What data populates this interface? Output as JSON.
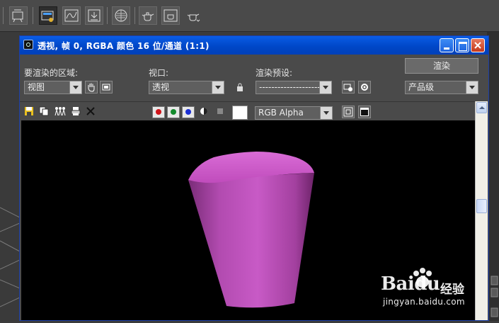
{
  "window": {
    "title": "透视, 帧 0, RGBA 颜色 16 位/通道 (1:1)"
  },
  "controls": {
    "area_label": "要渲染的区域:",
    "area_value": "视图",
    "viewport_label": "视口:",
    "viewport_value": "透视",
    "preset_label": "渲染预设:",
    "preset_value": "--------------------",
    "render_button": "渲染",
    "quality_value": "产品级"
  },
  "image_toolbar": {
    "channel_value": "RGB Alpha",
    "channels": [
      {
        "name": "red-channel",
        "color": "#d0141a"
      },
      {
        "name": "green-channel",
        "color": "#138a2c"
      },
      {
        "name": "blue-channel",
        "color": "#1b2fd4"
      }
    ],
    "swatch_color": "#ffffff"
  },
  "scene": {
    "background": "#000000",
    "object_color": "#c44fc2"
  },
  "watermark": {
    "brand": "Baidu",
    "product": "经验",
    "url": "jingyan.baidu.com"
  }
}
